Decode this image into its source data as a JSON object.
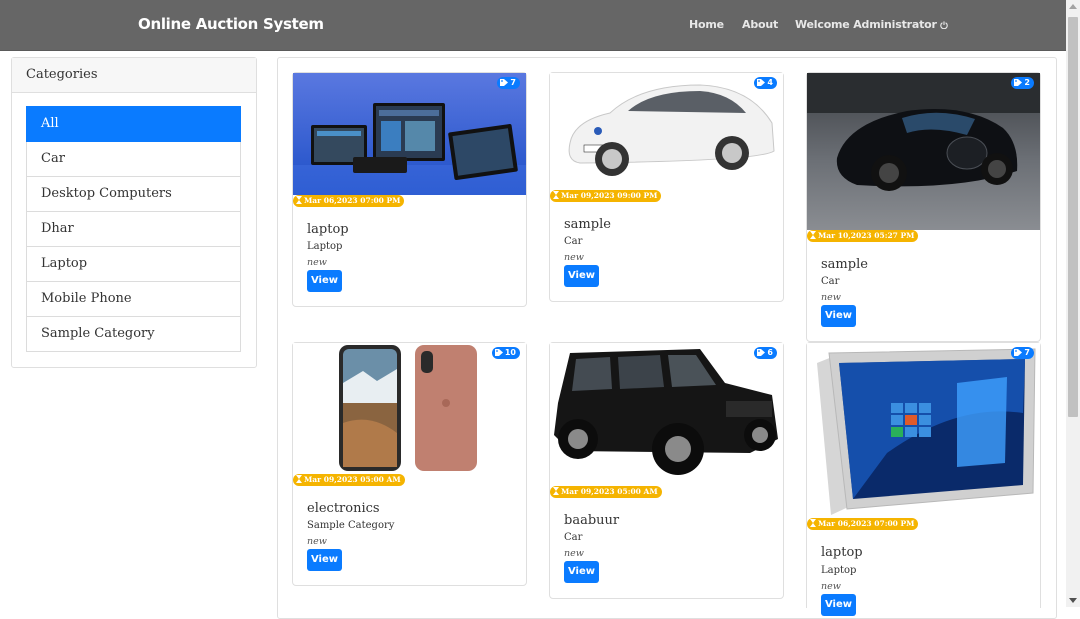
{
  "navbar": {
    "brand": "Online Auction System",
    "home": "Home",
    "about": "About",
    "welcome": "Welcome Administrator"
  },
  "categories": {
    "header": "Categories",
    "items": [
      "All",
      "Car",
      "Desktop Computers",
      "Dhar",
      "Laptop",
      "Mobile Phone",
      "Sample Category"
    ],
    "active": "All"
  },
  "items": [
    {
      "title": "laptop",
      "category": "Laptop",
      "condition": "new",
      "bids": "7",
      "date": "Mar 06,2023 07:00 PM",
      "button": "View"
    },
    {
      "title": "sample",
      "category": "Car",
      "condition": "new",
      "bids": "4",
      "date": "Mar 09,2023 09:00 PM",
      "button": "View"
    },
    {
      "title": "sample",
      "category": "Car",
      "condition": "new",
      "bids": "2",
      "date": "Mar 10,2023 05:27 PM",
      "button": "View"
    },
    {
      "title": "electronics",
      "category": "Sample Category",
      "condition": "new",
      "bids": "10",
      "date": "Mar 09,2023 05:00 AM",
      "button": "View"
    },
    {
      "title": "baabuur",
      "category": "Car",
      "condition": "new",
      "bids": "6",
      "date": "Mar 09,2023 05:00 AM",
      "button": "View"
    },
    {
      "title": "laptop",
      "category": "Laptop",
      "condition": "new",
      "bids": "7",
      "date": "Mar 06,2023 07:00 PM",
      "button": "View"
    }
  ],
  "colors": {
    "navbar": "#666666",
    "primary": "#0a7bff",
    "warning": "#f5b400"
  }
}
